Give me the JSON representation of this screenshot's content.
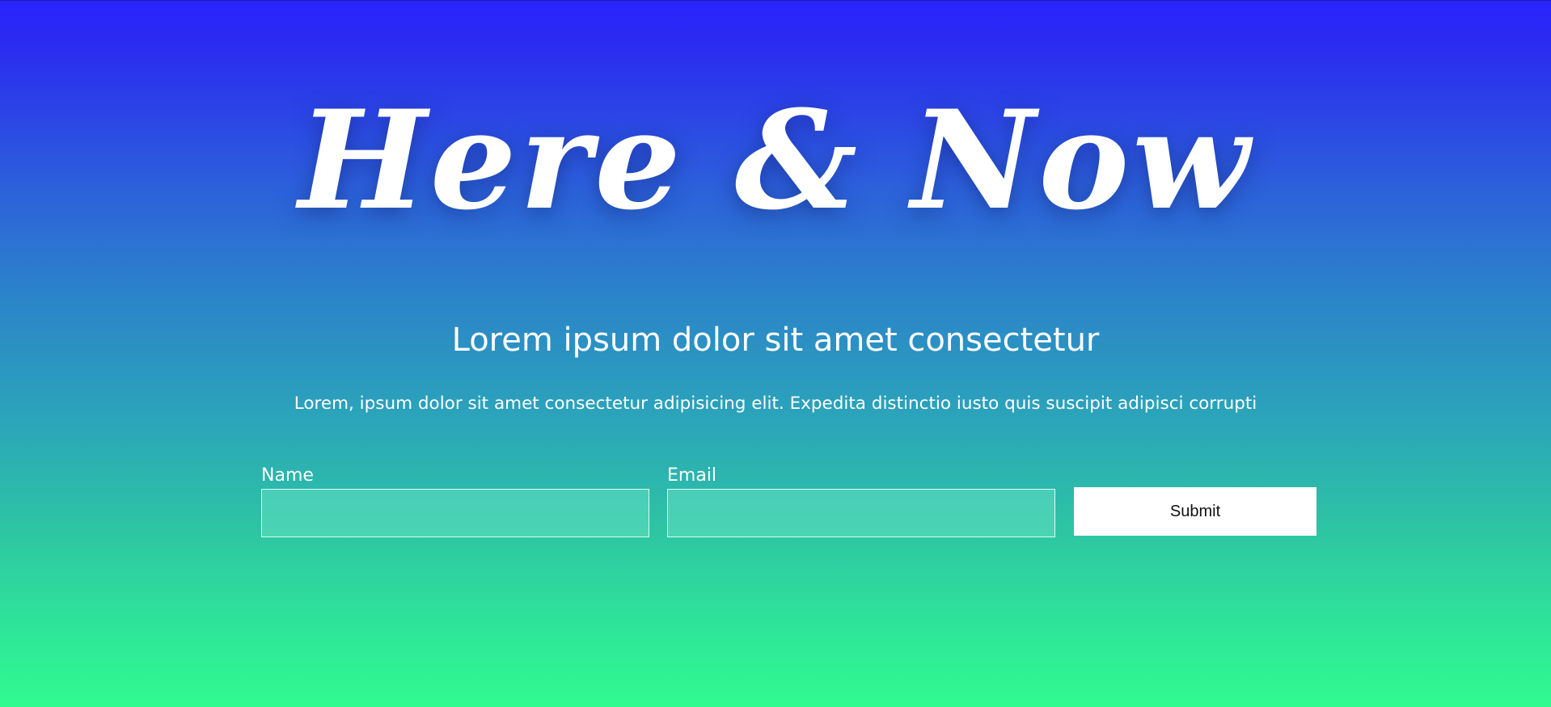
{
  "hero": {
    "headline": "Here & Now",
    "subtitle": "Lorem ipsum dolor sit amet consectetur",
    "lead": "Lorem, ipsum dolor sit amet consectetur adipisicing elit. Expedita distinctio iusto quis suscipit adipisci corrupti"
  },
  "form": {
    "name_label": "Name",
    "name_value": "",
    "email_label": "Email",
    "email_value": "",
    "submit_label": "Submit"
  },
  "colors": {
    "gradient_top": "#2a24ff",
    "gradient_bottom": "#30fb8f",
    "text": "#ffffff",
    "button_bg": "#ffffff"
  }
}
